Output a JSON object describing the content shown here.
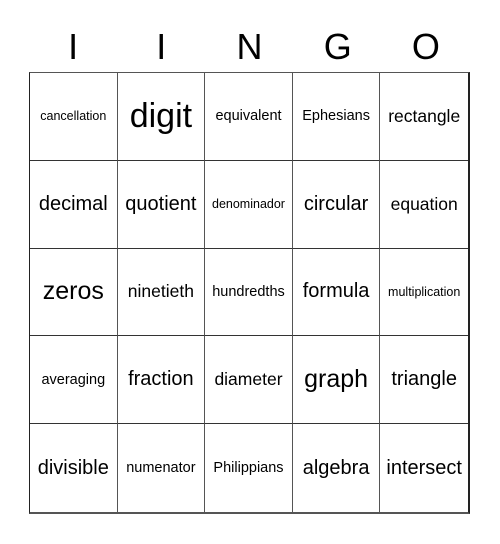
{
  "header": {
    "letters": [
      "I",
      "I",
      "N",
      "G",
      "O"
    ]
  },
  "board": {
    "cells": [
      {
        "text": "cancellation",
        "size": "s1"
      },
      {
        "text": "digit",
        "size": "s6"
      },
      {
        "text": "equivalent",
        "size": "s2"
      },
      {
        "text": "Ephesians",
        "size": "s2"
      },
      {
        "text": "rectangle",
        "size": "s3"
      },
      {
        "text": "decimal",
        "size": "s4"
      },
      {
        "text": "quotient",
        "size": "s4"
      },
      {
        "text": "denominador",
        "size": "s1"
      },
      {
        "text": "circular",
        "size": "s4"
      },
      {
        "text": "equation",
        "size": "s3"
      },
      {
        "text": "zeros",
        "size": "s5"
      },
      {
        "text": "ninetieth",
        "size": "s3"
      },
      {
        "text": "hundredths",
        "size": "s2"
      },
      {
        "text": "formula",
        "size": "s4"
      },
      {
        "text": "multiplication",
        "size": "s1"
      },
      {
        "text": "averaging",
        "size": "s2"
      },
      {
        "text": "fraction",
        "size": "s4"
      },
      {
        "text": "diameter",
        "size": "s3"
      },
      {
        "text": "graph",
        "size": "s5"
      },
      {
        "text": "triangle",
        "size": "s4"
      },
      {
        "text": "divisible",
        "size": "s4"
      },
      {
        "text": "numenator",
        "size": "s2"
      },
      {
        "text": "Philippians",
        "size": "s2"
      },
      {
        "text": "algebra",
        "size": "s4"
      },
      {
        "text": "intersect",
        "size": "s4"
      }
    ]
  }
}
